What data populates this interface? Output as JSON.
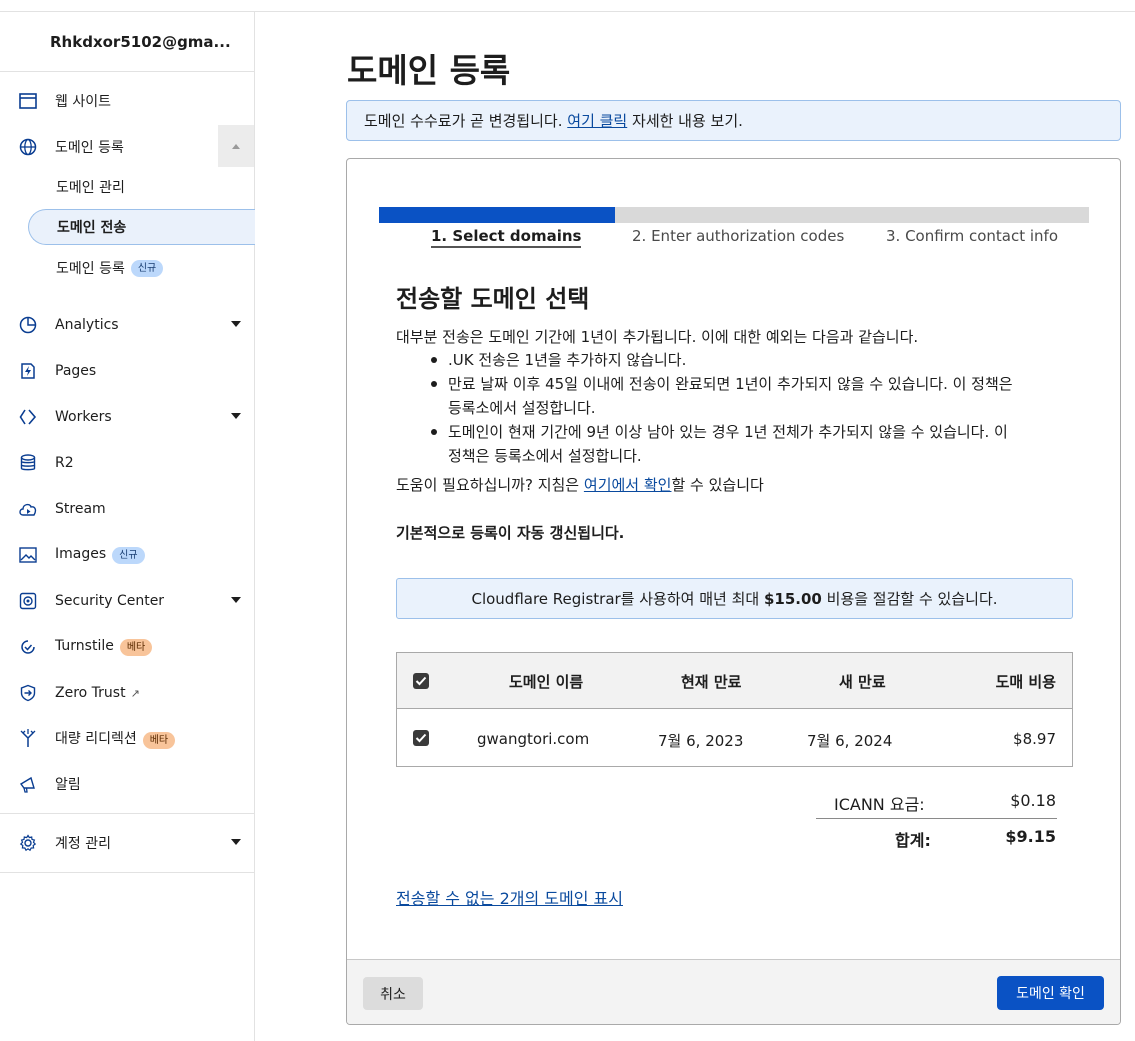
{
  "account": {
    "email": "Rhkdxor5102@gma..."
  },
  "sidebar": {
    "items": [
      {
        "label": "웹 사이트",
        "icon": "browser-window-icon"
      },
      {
        "label": "도메인 등록",
        "icon": "globe-icon"
      },
      {
        "label": "Analytics",
        "icon": "pie-chart-icon"
      },
      {
        "label": "Pages",
        "icon": "lightning-page-icon"
      },
      {
        "label": "Workers",
        "icon": "workers-chevrons-icon"
      },
      {
        "label": "R2",
        "icon": "database-icon"
      },
      {
        "label": "Stream",
        "icon": "cloud-play-icon"
      },
      {
        "label": "Images",
        "icon": "image-icon"
      },
      {
        "label": "Security Center",
        "icon": "security-target-icon"
      },
      {
        "label": "Turnstile",
        "icon": "turnstile-check-icon"
      },
      {
        "label": "Zero Trust",
        "icon": "zero-trust-shield-icon"
      },
      {
        "label": "대량 리디렉션",
        "icon": "redirect-fork-icon"
      },
      {
        "label": "알림",
        "icon": "megaphone-icon"
      },
      {
        "label": "계정 관리",
        "icon": "gear-icon"
      }
    ],
    "subitems": [
      {
        "label": "도메인 관리"
      },
      {
        "label": "도메인 전송"
      },
      {
        "label": "도메인 등록"
      }
    ],
    "badges": {
      "new": "신규",
      "beta": "베타"
    }
  },
  "main": {
    "title": "도메인 등록",
    "notice": {
      "before": "도메인 수수료가 곧 변경됩니다.",
      "link": "여기 클릭",
      "after": "자세한 내용 보기."
    }
  },
  "wizard": {
    "progress": 0.333,
    "steps": [
      "1. Select domains",
      "2. Enter authorization codes",
      "3. Confirm contact info"
    ]
  },
  "content": {
    "heading": "전송할 도메인 선택",
    "intro": "대부분 전송은 도메인 기간에 1년이 추가됩니다. 이에 대한 예외는 다음과 같습니다.",
    "bullets": [
      ".UK 전송은 1년을 추가하지 않습니다.",
      "만료 날짜 이후 45일 이내에 전송이 완료되면 1년이 추가되지 않을 수 있습니다. 이 정책은 등록소에서 설정합니다.",
      "도메인이 현재 기간에 9년 이상 남아 있는 경우 1년 전체가 추가되지 않을 수 있습니다. 이 정책은 등록소에서 설정합니다."
    ],
    "help_before": "도움이 필요하십니까? 지침은",
    "help_link": "여기에서 확인",
    "help_after": "할 수 있습니다",
    "auto_renew": "기본적으로 등록이 자동 갱신됩니다.",
    "savings_before": "Cloudflare Registrar를 사용하여 매년 최대",
    "savings_amount": "$15.00",
    "savings_after": "비용을 절감할 수 있습니다."
  },
  "table": {
    "headers": [
      "도메인 이름",
      "현재 만료",
      "새 만료",
      "도매 비용"
    ],
    "rows": [
      {
        "domain": "gwangtori.com",
        "current_expiry": "7월 6, 2023",
        "new_expiry": "7월 6, 2024",
        "cost": "$8.97",
        "checked": true
      }
    ]
  },
  "totals": {
    "icann_label": "ICANN 요금:",
    "icann_value": "$0.18",
    "total_label": "합계:",
    "total_value": "$9.15"
  },
  "untransferable_link": "전송할 수 없는 2개의 도메인 표시",
  "footer": {
    "cancel": "취소",
    "confirm": "도메인 확인"
  }
}
